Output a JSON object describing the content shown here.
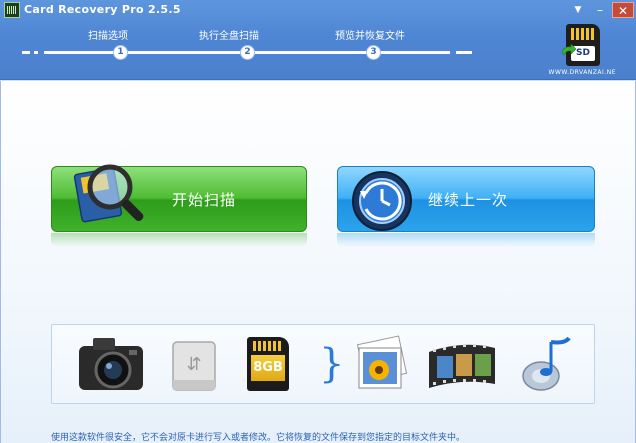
{
  "window": {
    "title": "Card Recovery Pro 2.5.5",
    "brand_url": "WWW.DRVANZAI.NE"
  },
  "logo": {
    "card_text": "SD"
  },
  "steps": [
    {
      "label": "扫描选项",
      "number": "1"
    },
    {
      "label": "执行全盘扫描",
      "number": "2"
    },
    {
      "label": "预览并恢复文件",
      "number": "3"
    }
  ],
  "actions": {
    "start_scan": "开始扫描",
    "resume_last": "继续上一次"
  },
  "media": {
    "sd_card_text": "8GB",
    "items": [
      "camera-icon",
      "usb-drive-icon",
      "memory-card-icon",
      "photo-icon",
      "film-strip-icon",
      "music-note-icon"
    ]
  },
  "footer": {
    "message": "使用这款软件很安全，它不会对原卡进行写入或者修改。它将恢复的文件保存到您指定的目标文件夹中。"
  },
  "colors": {
    "header": "#4f86d4",
    "scan_button": "#3fb12a",
    "resume_button": "#2ca3ec",
    "footer_text": "#2b62b4"
  }
}
